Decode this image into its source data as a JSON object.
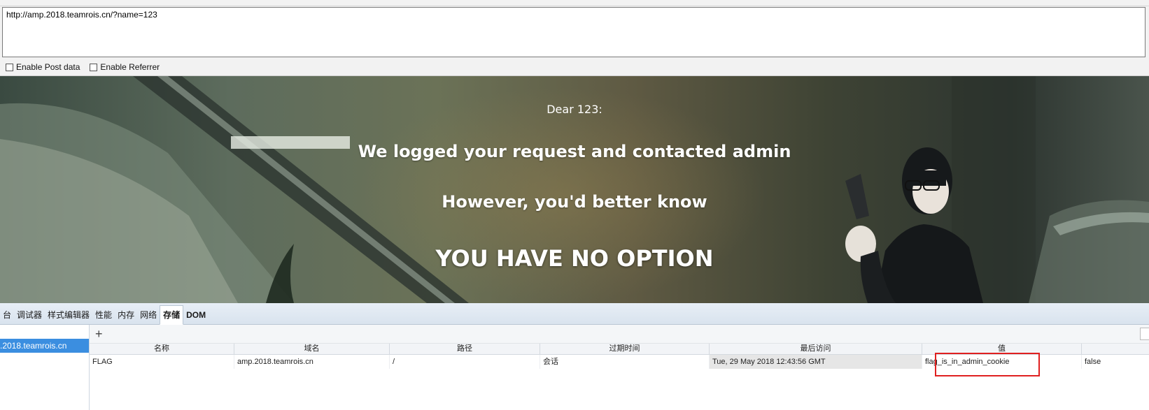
{
  "hackbar": {
    "url": "http://amp.2018.teamrois.cn/?name=123",
    "enable_post_label": "Enable Post data",
    "enable_referrer_label": "Enable Referrer"
  },
  "page": {
    "dear": "Dear 123:",
    "logged": "We logged your request and contacted admin",
    "however": "However, you'd better know",
    "no_option": "YOU HAVE NO OPTION"
  },
  "devtools": {
    "tabs": [
      "台",
      "调试器",
      "样式编辑器",
      "性能",
      "内存",
      "网络",
      "存储",
      "DOM"
    ],
    "active_tab": "存储",
    "sidebar_item": ".2018.teamrois.cn",
    "add_icon": "plus-icon",
    "columns": [
      "名称",
      "域名",
      "路径",
      "过期时间",
      "最后访问",
      "值"
    ],
    "rows": [
      {
        "name": "FLAG",
        "domain": "amp.2018.teamrois.cn",
        "path": "/",
        "expires": "会话",
        "last_accessed": "Tue, 29 May 2018 12:43:56 GMT",
        "value": "flag_is_in_admin_cookie",
        "http_only": "false"
      }
    ]
  },
  "colors": {
    "highlight_box": "#e02020",
    "selected_sidebar": "#3b8ee0",
    "tab_bar": "#dde6f0"
  }
}
